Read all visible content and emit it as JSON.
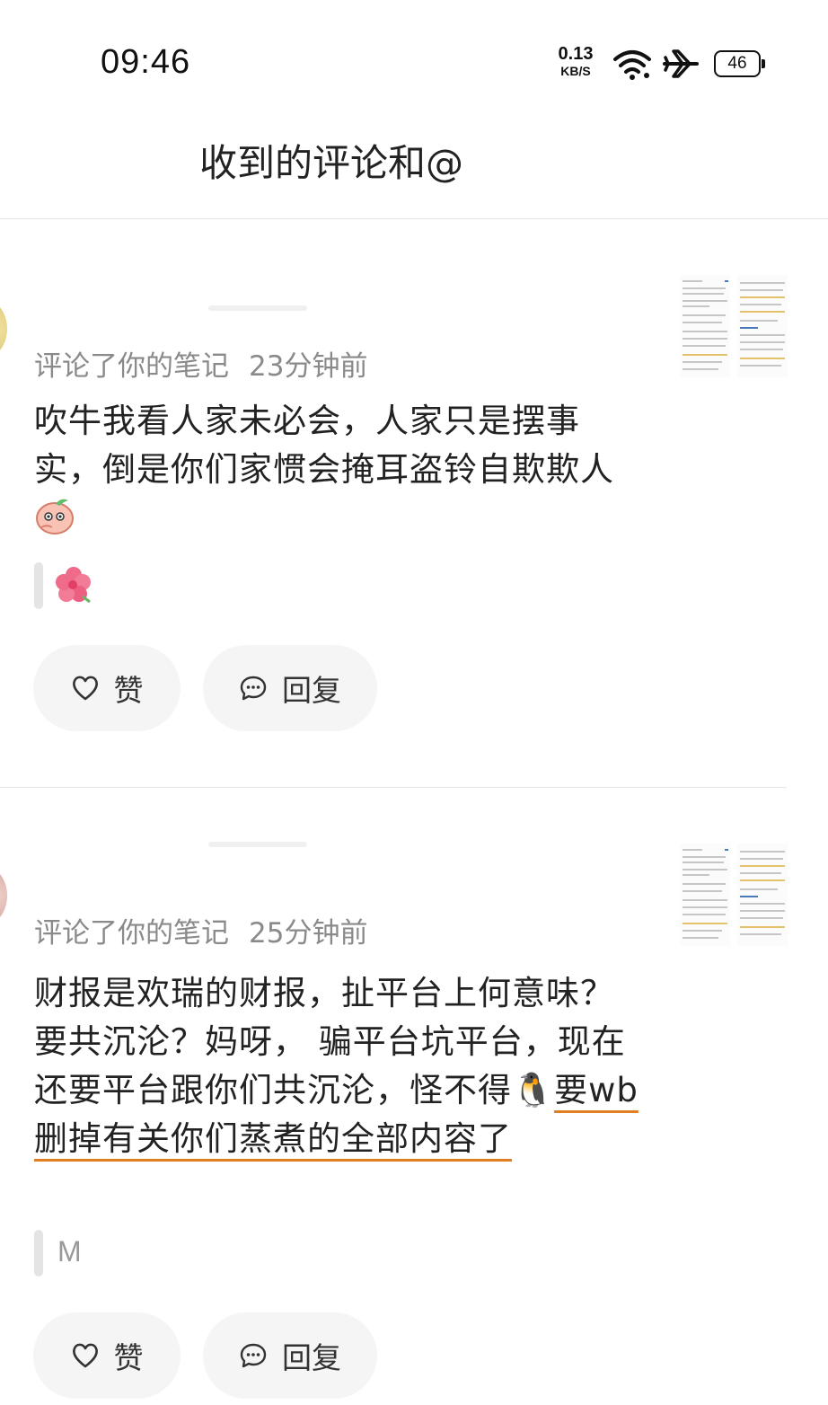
{
  "status_bar": {
    "time": "09:46",
    "net_speed_value": "0.13",
    "net_speed_unit": "KB/S",
    "battery": "46",
    "icons": [
      "wifi-icon",
      "airplane-icon",
      "battery-icon"
    ]
  },
  "header": {
    "title": "收到的评论和@"
  },
  "comments": [
    {
      "action": "评论了你的笔记",
      "time": "23分钟前",
      "text": "吹牛我看人家未必会，人家只是摆事实，倒是你们家惯会掩耳盗铃自欺欺人",
      "emoji": "peach-thinking-emoji",
      "quote_text": "",
      "quote_icon": "flower-emoji",
      "like_label": "赞",
      "reply_label": "回复"
    },
    {
      "action": "评论了你的笔记",
      "time": "25分钟前",
      "text_before": "财报是欢瑞的财报，扯平台上何意味？要共沉沦？妈呀， 骗平台坑平台，现在还要平台跟你们共沉沦，怪不得",
      "emoji": "🐧",
      "text_underlined": "要wb删掉有关你们蒸煮的全部内容了",
      "quote_text": "M",
      "like_label": "赞",
      "reply_label": "回复"
    }
  ],
  "colors": {
    "underline": "#e07f22",
    "button_bg": "#f5f5f5",
    "meta_text": "#8a8a8a"
  }
}
